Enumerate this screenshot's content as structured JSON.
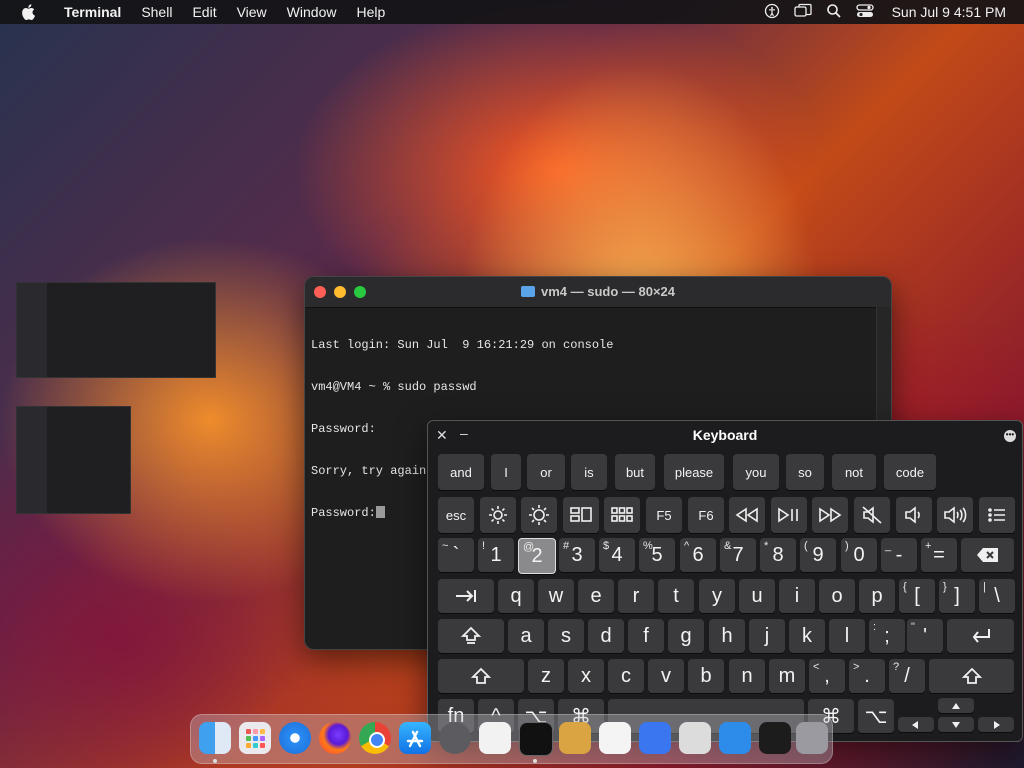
{
  "menubar": {
    "app_name": "Terminal",
    "items": [
      "Shell",
      "Edit",
      "View",
      "Window",
      "Help"
    ],
    "clock": "Sun Jul 9  4:51 PM"
  },
  "terminal": {
    "title": "vm4 — sudo — 80×24",
    "lines": [
      "Last login: Sun Jul  9 16:21:29 on console",
      "vm4@VM4 ~ % sudo passwd",
      "Password:",
      "Sorry, try again.",
      "Password:"
    ]
  },
  "keyboard": {
    "title": "Keyboard",
    "suggestions": [
      "and",
      "I",
      "or",
      "is",
      "but",
      "please",
      "you",
      "so",
      "not",
      "code"
    ],
    "fn_row": [
      "esc",
      "",
      "",
      "",
      "",
      "F5",
      "F6",
      "",
      "",
      "",
      "",
      "",
      "",
      ""
    ],
    "number_row": {
      "tilde": {
        "shift": "~",
        "main": "`"
      },
      "keys": [
        {
          "shift": "!",
          "main": "1"
        },
        {
          "shift": "@",
          "main": "2"
        },
        {
          "shift": "#",
          "main": "3"
        },
        {
          "shift": "$",
          "main": "4"
        },
        {
          "shift": "%",
          "main": "5"
        },
        {
          "shift": "^",
          "main": "6"
        },
        {
          "shift": "&",
          "main": "7"
        },
        {
          "shift": "*",
          "main": "8"
        },
        {
          "shift": "(",
          "main": "9"
        },
        {
          "shift": ")",
          "main": "0"
        },
        {
          "shift": "_",
          "main": "-"
        },
        {
          "shift": "+",
          "main": "="
        }
      ]
    },
    "row_q": [
      "q",
      "w",
      "e",
      "r",
      "t",
      "y",
      "u",
      "i",
      "o",
      "p"
    ],
    "row_q_punct": [
      {
        "shift": "{",
        "main": "["
      },
      {
        "shift": "}",
        "main": "]"
      },
      {
        "shift": "|",
        "main": "\\"
      }
    ],
    "row_a": [
      "a",
      "s",
      "d",
      "f",
      "g",
      "h",
      "j",
      "k",
      "l"
    ],
    "row_a_punct": [
      {
        "shift": ":",
        "main": ";"
      },
      {
        "shift": "\"",
        "main": "'"
      }
    ],
    "row_z": [
      "z",
      "x",
      "c",
      "v",
      "b",
      "n",
      "m"
    ],
    "row_z_punct": [
      {
        "shift": "<",
        "main": ","
      },
      {
        "shift": ">",
        "main": "."
      },
      {
        "shift": "?",
        "main": "/"
      }
    ],
    "bottom": {
      "fn": "fn",
      "ctrl": "^",
      "opt": "⌥",
      "cmd": "⌘"
    }
  },
  "colors": {
    "traffic_red": "#ff5f57",
    "traffic_yellow": "#febc2e",
    "traffic_green": "#28c840"
  }
}
